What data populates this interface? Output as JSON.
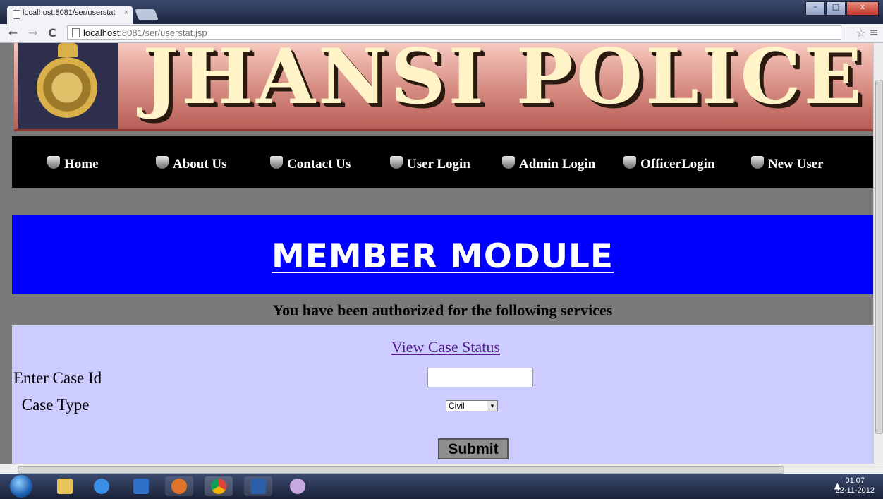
{
  "browser": {
    "tab_title": "localhost:8081/ser/userstat",
    "tab_close": "×",
    "url_host": "localhost",
    "url_path": ":8081/ser/userstat.jsp",
    "nav_back": "←",
    "nav_forward": "→",
    "nav_reload": "C",
    "star": "☆",
    "menu": "≡",
    "win_min": "–",
    "win_max": "□",
    "win_close": "x"
  },
  "banner": {
    "title": "JHANSI POLICE"
  },
  "nav": {
    "items": [
      "Home",
      "About Us",
      "Contact Us",
      "User Login",
      "Admin Login",
      "OfficerLogin",
      "New User"
    ]
  },
  "module": {
    "title": "MEMBER MODULE",
    "authorized_text": "You have been authorized for the following services"
  },
  "form": {
    "link_label": "View Case Status",
    "case_id_label": "Enter Case Id",
    "case_id_value": "",
    "case_type_label": " Case Type",
    "case_type_selected": "Civil",
    "select_arrow": "▾",
    "submit_label": "Submit"
  },
  "taskbar": {
    "tray_arrow": "▲",
    "clock_time": "01:07",
    "clock_date": "22-11-2012"
  },
  "colors": {
    "module_bg": "#0000ff",
    "form_bg": "#ccccff",
    "page_bg": "#7a7a7a",
    "nav_bg": "#000000",
    "link": "#551a8b"
  }
}
